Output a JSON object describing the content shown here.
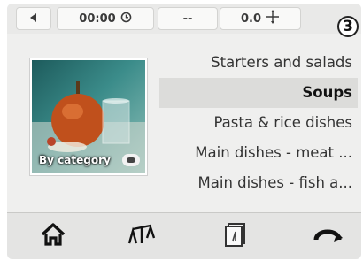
{
  "status": {
    "back_icon": "arrow-left-icon",
    "timer_value": "00:00",
    "timer_icon": "clock-icon",
    "temperature_value": "--",
    "weight_value": "0.0",
    "weight_icon": "scale-arrows-icon"
  },
  "step_badge": "3",
  "category": {
    "label": "By category",
    "toggle_icon": "toggle-icon"
  },
  "recipe_list": {
    "items": [
      {
        "label": "Starters and salads",
        "selected": false
      },
      {
        "label": "Soups",
        "selected": true
      },
      {
        "label": "Pasta & rice dishes",
        "selected": false
      },
      {
        "label": "Main dishes - meat ...",
        "selected": false
      },
      {
        "label": "Main dishes - fish a...",
        "selected": false
      }
    ]
  },
  "toolbar": {
    "home_icon": "home-icon",
    "scale_icon": "scale-icon",
    "recipe_book_icon": "recipe-book-icon",
    "turbo_icon": "turbo-icon"
  },
  "colors": {
    "screen_bg": "#efefee",
    "selected_row": "#dcdcda",
    "toolbar_bg": "#e4e4e3"
  }
}
